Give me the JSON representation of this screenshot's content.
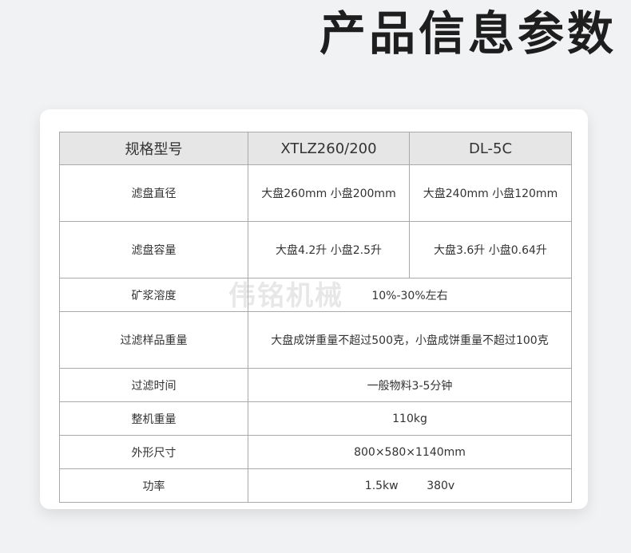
{
  "page": {
    "title": "产品信息参数"
  },
  "watermark": "伟铭机械",
  "table": {
    "headers": [
      "规格型号",
      "XTLZ260/200",
      "DL-5C"
    ],
    "rows": [
      {
        "label": "滤盘直径",
        "col1": "大盘260mm  小盘200mm",
        "col2": "大盘240mm  小盘120mm"
      },
      {
        "label": "滤盘容量",
        "col1": "大盘4.2升  小盘2.5升",
        "col2": "大盘3.6升  小盘0.64升"
      },
      {
        "label": "矿浆溶度",
        "merged": "10%-30%左右"
      },
      {
        "label": "过滤样品重量",
        "merged": "大盘成饼重量不超过500克，小盘成饼重量不超过100克"
      },
      {
        "label": "过滤时间",
        "merged": "一般物料3-5分钟"
      },
      {
        "label": "整机重量",
        "merged": "110kg"
      },
      {
        "label": "外形尺寸",
        "merged": "800×580×1140mm"
      },
      {
        "label": "功率",
        "merged": "1.5kw        380v"
      }
    ]
  },
  "colors": {
    "header_bg": "#e6e6e6",
    "border": "#a9a9a9",
    "page_bg": "#f1f2f4"
  }
}
